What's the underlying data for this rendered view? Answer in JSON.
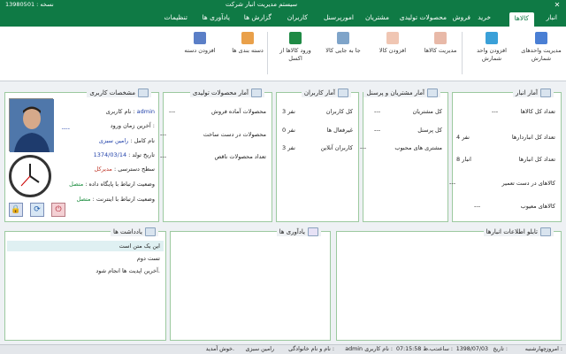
{
  "window": {
    "title": "سیستم مدیریت انبار شرکت",
    "version": "نسخه : 13980501"
  },
  "tabs": [
    "انبار",
    "کالاها",
    "خرید",
    "فروش",
    "محصولات تولیدی",
    "مشتریان",
    "امورپرسنل",
    "کاربران",
    "گزارش ها",
    "یادآوری ها",
    "تنظیمات"
  ],
  "ribbon": {
    "units": "مدیریت واحدهای شمارش",
    "add_unit": "افزودن واحد شمارش",
    "manage_goods": "مدیریت کالاها",
    "add_goods": "افزودن کالا",
    "move_goods": "جا به جایی کالا",
    "import_excel": "ورود کالاها از اکسل",
    "categories": "دسته بندی ها",
    "add_category": "افزودن دسته"
  },
  "warehouse": {
    "title": "آمار انبار",
    "rows": [
      {
        "label": "تعداد کل کالاها",
        "value": "---"
      },
      {
        "label": "تعداد کل انباردارها",
        "value": "4 نفر"
      },
      {
        "label": "تعداد کل انبارها",
        "value": "8 انبار"
      },
      {
        "label": "کالاهای در دست تعمیر",
        "value": "---"
      },
      {
        "label": "کالاهای معیوب",
        "value": "---"
      }
    ]
  },
  "customers": {
    "title": "آمار مشتریان و پرسنل",
    "rows": [
      {
        "label": "کل مشتریان",
        "value": "---"
      },
      {
        "label": "کل پرسنل",
        "value": "---"
      },
      {
        "label": "مشتری های محبوب",
        "value": "---"
      }
    ]
  },
  "users": {
    "title": "آمار کاربران",
    "rows": [
      {
        "label": "کل کاربران",
        "value": "3 نفر"
      },
      {
        "label": "غیرفعال ها",
        "value": "0 نفر"
      },
      {
        "label": "کاربران آنلاین",
        "value": "3 نفر"
      }
    ]
  },
  "products": {
    "title": "آمار محصولات تولیدی",
    "rows": [
      {
        "label": "محصولات آماده فروش",
        "value": "---"
      },
      {
        "label": "محصولات در دست ساخت",
        "value": "---"
      },
      {
        "label": "تعداد محصولات ناقص",
        "value": "---"
      }
    ]
  },
  "profile": {
    "title": "مشخصات کاربری",
    "username_label": "نام کاربری :",
    "username": "admin",
    "last_login_label": "آخرین زمان ورود :",
    "last_login": "----",
    "fullname_label": "نام کامل :",
    "fullname": "رامین سبزی",
    "birth_label": "تاریخ تولد :",
    "birth": "1374/03/14",
    "access_label": "سطح دسترسی :",
    "access": "مدیرکل",
    "db_label": "وضعیت ارتباط با پایگاه داده :",
    "db": "متصل",
    "net_label": "وضعیت ارتباط با اینترنت :",
    "net": "متصل"
  },
  "board": {
    "title": "تابلو اطلاعات انبارها"
  },
  "reminders": {
    "title": "یادآوری ها"
  },
  "notes": {
    "title": "یادداشت ها",
    "items": [
      "این یک متن است",
      "تست دوم",
      "آخرین اپدیت ها انجام شود."
    ]
  },
  "status": {
    "today_label": "امروز :",
    "today": "چهارشنبه",
    "date_label": "تاریخ :",
    "date": "1398/07/03",
    "time_label": "ساعت :",
    "time": "07:15:58 ب.ظ",
    "user_label": "نام کاربری :",
    "user": "admin",
    "name_label": "نام و نام خانوادگی :",
    "name": "رامین سبزی",
    "welcome": "خوش آمدید."
  },
  "colors": {
    "accent": "#0f7a45",
    "panel_border": "#9cc99f"
  }
}
